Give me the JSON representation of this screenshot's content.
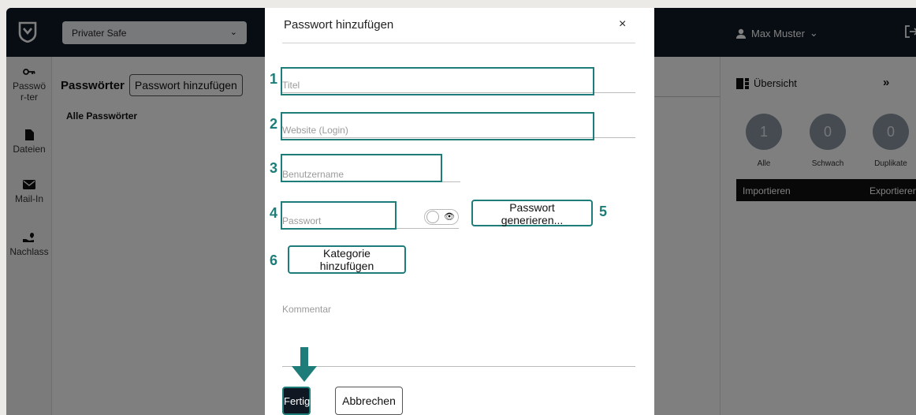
{
  "topbar": {
    "safe_select": "Privater Safe",
    "user_name": "Max Muster"
  },
  "sidebar": {
    "items": [
      {
        "label": "Passwör-ter"
      },
      {
        "label": "Dateien"
      },
      {
        "label": "Mail-In"
      },
      {
        "label": "Nachlass"
      }
    ]
  },
  "passwords": {
    "title": "Passwörter",
    "add_button": "Passwort hinzufügen",
    "filter_all": "Alle Passwörter"
  },
  "overview": {
    "title": "Übersicht",
    "expand": "»",
    "counts": [
      {
        "label": "Alle",
        "value": "1"
      },
      {
        "label": "Schwach",
        "value": "0"
      },
      {
        "label": "Duplikate",
        "value": "0"
      }
    ],
    "import_label": "Importieren",
    "export_label": "Exportieren"
  },
  "modal": {
    "title": "Passwort hinzufügen",
    "close": "×",
    "fields": {
      "title_placeholder": "Titel",
      "website_placeholder": "Website (Login)",
      "username_placeholder": "Benutzername",
      "password_placeholder": "Passwort",
      "comment_placeholder": "Kommentar"
    },
    "generate_button": "Passwort generieren...",
    "category_button": "Kategorie hinzufügen",
    "done_button": "Fertig",
    "cancel_button": "Abbrechen"
  },
  "annotations": {
    "numbers": [
      "1",
      "2",
      "3",
      "4",
      "5",
      "6"
    ],
    "color": "#1e7d79"
  }
}
